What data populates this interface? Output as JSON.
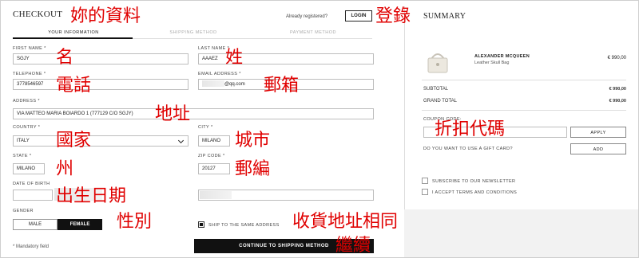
{
  "header": {
    "checkout_title": "CHECKOUT",
    "already_registered": "Already registered?",
    "login_button": "LOGIN",
    "summary_title": "SUMMARY"
  },
  "tabs": [
    {
      "label": "YOUR INFORMATION",
      "active": true
    },
    {
      "label": "SHIPPING METHOD",
      "active": false
    },
    {
      "label": "PAYMENT METHOD",
      "active": false
    }
  ],
  "form": {
    "first_name_label": "FIRST NAME *",
    "first_name_value": "SGJY",
    "last_name_label": "LAST NAME *",
    "last_name_value": "AAAEZ",
    "telephone_label": "TELEPHONE *",
    "telephone_value": "3778546597",
    "email_label": "EMAIL ADDRESS *",
    "email_value": "@qq.com",
    "address_label": "ADDRESS *",
    "address_value": "VIA MATTEO MARIA BOIARDO 1 (777129 C/O SGJY)",
    "country_label": "COUNTRY *",
    "country_value": "ITALY",
    "city_label": "CITY *",
    "city_value": "MILANO",
    "state_label": "STATE *",
    "state_value": "MILANO",
    "zip_label": "ZIP CODE *",
    "zip_value": "20127",
    "dob_label": "DATE OF BIRTH",
    "gender_label": "GENDER",
    "gender_male": "MALE",
    "gender_female": "FEMALE",
    "ship_same_label": "SHIP TO THE SAME ADDRESS",
    "continue_button": "CONTINUE TO SHIPPING METHOD",
    "mandatory_note": "* Mandatory field"
  },
  "summary": {
    "brand": "ALEXANDER MCQUEEN",
    "product": "Leather Skull Bag",
    "price": "€ 990,00",
    "subtotal_label": "SUBTOTAL",
    "subtotal_value": "€ 990,00",
    "grand_total_label": "GRAND TOTAL",
    "grand_total_value": "€ 990,00",
    "coupon_label": "COUPON CODE:",
    "apply_button": "APPLY",
    "gift_card_label": "DO YOU WANT TO USE A GIFT CARD?",
    "add_button": "ADD",
    "newsletter_label": "SUBSCRIBE TO OUR NEWSLETTER",
    "terms_label": "I ACCEPT TERMS AND CONDITIONS"
  },
  "annotations": {
    "your_info": "妳的資料",
    "login": "登錄",
    "first_name": "名",
    "last_name": "姓",
    "telephone": "電話",
    "email": "郵箱",
    "address": "地址",
    "coupon": "折扣代碼",
    "country": "國家",
    "city": "城市",
    "state": "州",
    "zip": "郵編",
    "dob": "出生日期",
    "gender": "性別",
    "ship_same": "收貨地址相同",
    "continue": "繼續"
  },
  "colors": {
    "annotation": "#e00000",
    "button_dark": "#111111",
    "panel_bg": "#f2f2f2"
  }
}
